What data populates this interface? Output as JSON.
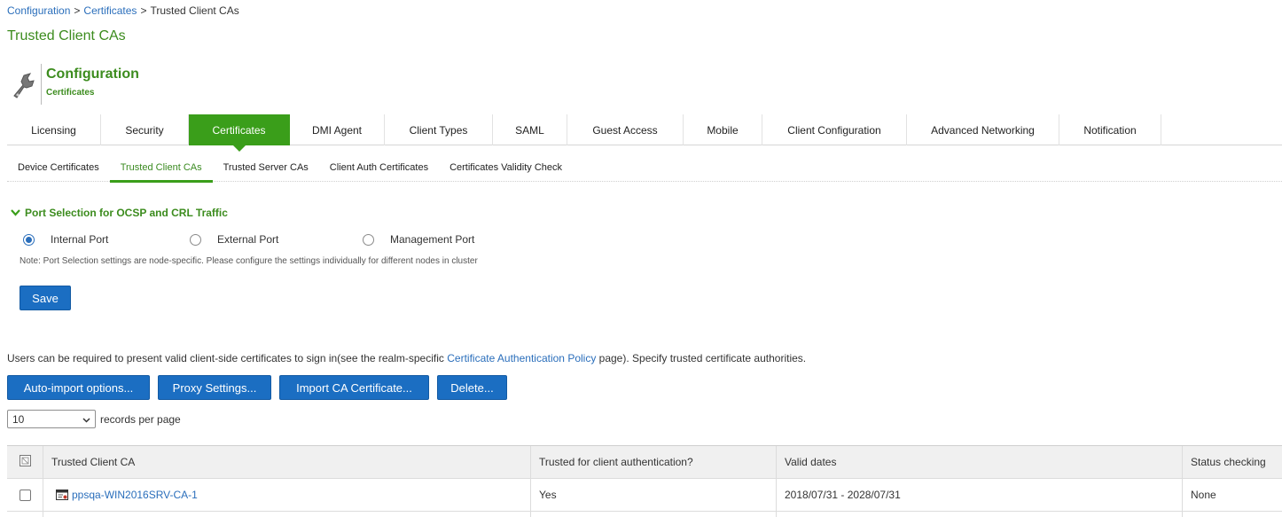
{
  "breadcrumb": {
    "items": [
      "Configuration",
      "Certificates",
      "Trusted Client CAs"
    ],
    "separator": ">"
  },
  "page_title": "Trusted Client CAs",
  "section": {
    "title": "Configuration",
    "subtitle": "Certificates",
    "icon": "wrench-icon"
  },
  "main_tabs": [
    {
      "label": "Licensing"
    },
    {
      "label": "Security"
    },
    {
      "label": "Certificates",
      "active": true
    },
    {
      "label": "DMI Agent"
    },
    {
      "label": "Client Types"
    },
    {
      "label": "SAML"
    },
    {
      "label": "Guest Access"
    },
    {
      "label": "Mobile"
    },
    {
      "label": "Client Configuration"
    },
    {
      "label": "Advanced Networking"
    },
    {
      "label": "Notification"
    }
  ],
  "sub_tabs": [
    {
      "label": "Device Certificates"
    },
    {
      "label": "Trusted Client CAs",
      "active": true
    },
    {
      "label": "Trusted Server CAs"
    },
    {
      "label": "Client Auth Certificates"
    },
    {
      "label": "Certificates Validity Check"
    }
  ],
  "port_selection": {
    "heading": "Port Selection for OCSP and CRL Traffic",
    "options": [
      {
        "label": "Internal Port",
        "checked": true
      },
      {
        "label": "External Port",
        "checked": false
      },
      {
        "label": "Management Port",
        "checked": false
      }
    ],
    "note": "Note: Port Selection settings are node-specific. Please configure the settings individually for different nodes in cluster",
    "save_label": "Save"
  },
  "intro": {
    "before": "Users can be required to present valid client-side certificates to sign in(see the realm-specific ",
    "link": "Certificate Authentication Policy",
    "after": " page). Specify trusted certificate authorities."
  },
  "actions": {
    "auto_import": "Auto-import options...",
    "proxy": "Proxy Settings...",
    "import_ca": "Import CA Certificate...",
    "delete": "Delete..."
  },
  "pagination": {
    "page_size": "10",
    "label": "records per page"
  },
  "table": {
    "columns": [
      "Trusted Client CA",
      "Trusted for client authentication?",
      "Valid dates",
      "Status checking"
    ],
    "rows": [
      {
        "name": "ppsqa-WIN2016SRV-CA-1",
        "trusted": "Yes",
        "valid_dates": "2018/07/31 - 2028/07/31",
        "status": "None"
      }
    ]
  },
  "colors": {
    "accent_green": "#3a9e1a",
    "title_green": "#3c8c1e",
    "button_blue": "#1b6ec2",
    "link_blue": "#2a6ebb"
  }
}
